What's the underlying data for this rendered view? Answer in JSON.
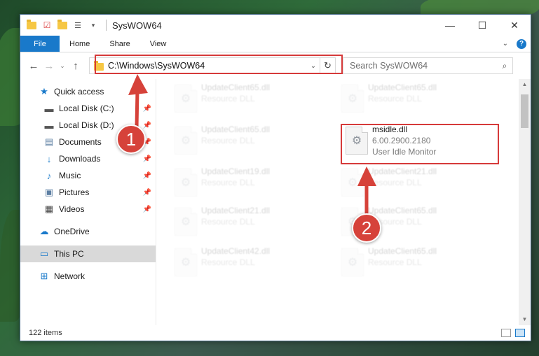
{
  "window": {
    "title": "SysWOW64",
    "controls": {
      "minimize": "—",
      "maximize": "☐",
      "close": "✕"
    }
  },
  "ribbon": {
    "tabs": [
      "File",
      "Home",
      "Share",
      "View"
    ],
    "help": "?"
  },
  "navigation": {
    "back": "←",
    "forward": "→",
    "recent": "⌄",
    "up": "↑",
    "address": "C:\\Windows\\SysWOW64",
    "search_placeholder": "Search SysWOW64"
  },
  "sidebar": {
    "items": [
      {
        "label": "Quick access",
        "icon": "star-icon",
        "glyph": "★"
      },
      {
        "label": "Local Disk (C:)",
        "icon": "drive-icon",
        "glyph": "▬",
        "pinned": true
      },
      {
        "label": "Local Disk (D:)",
        "icon": "drive-icon",
        "glyph": "▬",
        "pinned": true
      },
      {
        "label": "Documents",
        "icon": "documents-icon",
        "glyph": "▤",
        "pinned": true
      },
      {
        "label": "Downloads",
        "icon": "download-icon",
        "glyph": "↓",
        "pinned": true
      },
      {
        "label": "Music",
        "icon": "music-icon",
        "glyph": "♪",
        "pinned": true
      },
      {
        "label": "Pictures",
        "icon": "pictures-icon",
        "glyph": "▣",
        "pinned": true
      },
      {
        "label": "Videos",
        "icon": "videos-icon",
        "glyph": "▦",
        "pinned": true
      },
      {
        "label": "OneDrive",
        "icon": "cloud-icon",
        "glyph": "☁"
      },
      {
        "label": "This PC",
        "icon": "computer-icon",
        "glyph": "▭"
      },
      {
        "label": "Network",
        "icon": "network-icon",
        "glyph": "⊞"
      }
    ]
  },
  "files": [
    {
      "name": "UpdateClient65.dll",
      "line2": "Resource DLL"
    },
    {
      "name": "UpdateClient65.dll",
      "line2": "Resource DLL"
    },
    {
      "name": "UpdateClient65.dll",
      "line2": "Resource DLL"
    },
    {
      "name": "msidle.dll",
      "line2": "6.00.2900.2180",
      "line3": "User Idle Monitor"
    },
    {
      "name": "UpdateClient19.dll",
      "line2": "Resource DLL"
    },
    {
      "name": "UpdateClient21.dll",
      "line2": "Resource DLL"
    },
    {
      "name": "UpdateClient21.dll",
      "line2": "Resource DLL"
    },
    {
      "name": "UpdateClient65.dll",
      "line2": "Resource DLL"
    },
    {
      "name": "UpdateClient42.dll",
      "line2": "Resource DLL"
    },
    {
      "name": "UpdateClient65.dll",
      "line2": "Resource DLL"
    }
  ],
  "status": {
    "item_count": "122 items"
  },
  "markers": [
    "1",
    "2"
  ],
  "colors": {
    "accent": "#1979ca",
    "highlight": "#d63a3a",
    "marker": "#d6423a"
  }
}
